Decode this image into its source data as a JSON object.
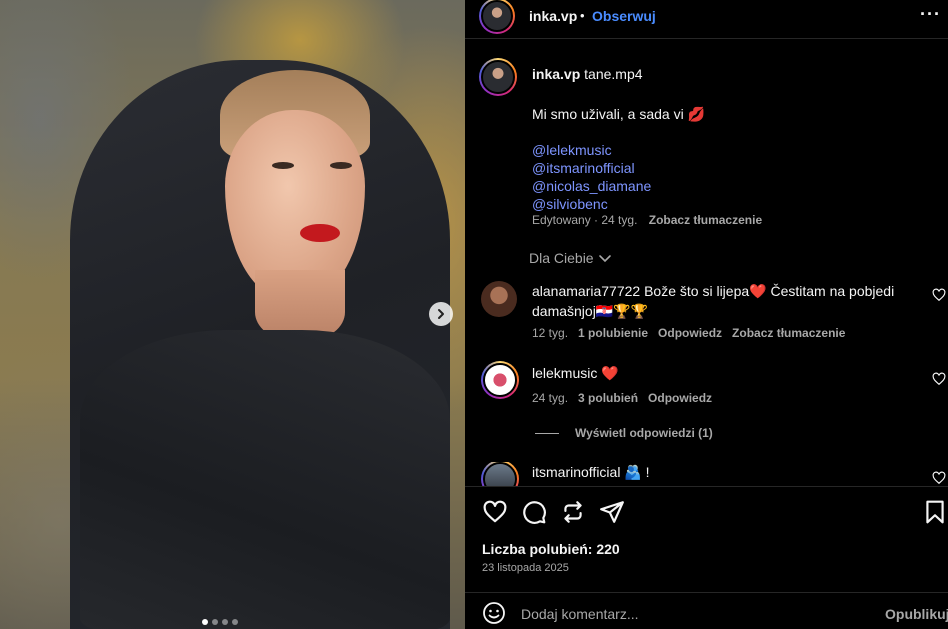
{
  "header": {
    "username": "inka.vp",
    "separator": "•",
    "follow_label": "Obserwuj",
    "more_label": "···"
  },
  "caption": {
    "username": "inka.vp",
    "title": "tane.mp4",
    "text": "Mi smo uživali, a sada vi",
    "emoji": "💋",
    "mentions": [
      "@lelekmusic",
      "@itsmarinofficial",
      "@nicolas_diamane",
      "@silviobenc"
    ],
    "edited": "Edytowany",
    "age": "24 tyg.",
    "translate": "Zobacz tłumaczenie"
  },
  "sort": {
    "label": "Dla Ciebie"
  },
  "comments": [
    {
      "username": "alanamaria77722",
      "text": "Bože što si lijepa❤️ Čestitam na pobjedi damašnjoj🇭🇷🏆🏆",
      "age": "12 tyg.",
      "likes": "1 polubienie",
      "reply": "Odpowiedz",
      "translate": "Zobacz tłumaczenie"
    },
    {
      "username": "lelekmusic",
      "text": "❤️",
      "age": "24 tyg.",
      "likes": "3 polubień",
      "reply": "Odpowiedz"
    },
    {
      "username": "itsmarinofficial",
      "text": "🫂 !"
    }
  ],
  "view_replies": "Wyświetl odpowiedzi (1)",
  "likes_text": "Liczba polubień: 220",
  "date": "23 listopada 2025",
  "add_comment": {
    "placeholder": "Dodaj komentarz...",
    "post_label": "Opublikuj"
  },
  "colors": {
    "link": "#4a8cff",
    "mention": "#7e95ff",
    "heart": "#ff3040"
  },
  "icons": [
    "heart-icon",
    "comment-icon",
    "repost-icon",
    "share-icon",
    "bookmark-icon",
    "smiley-icon",
    "chevron-right-icon",
    "chevron-down-icon",
    "more-icon"
  ]
}
